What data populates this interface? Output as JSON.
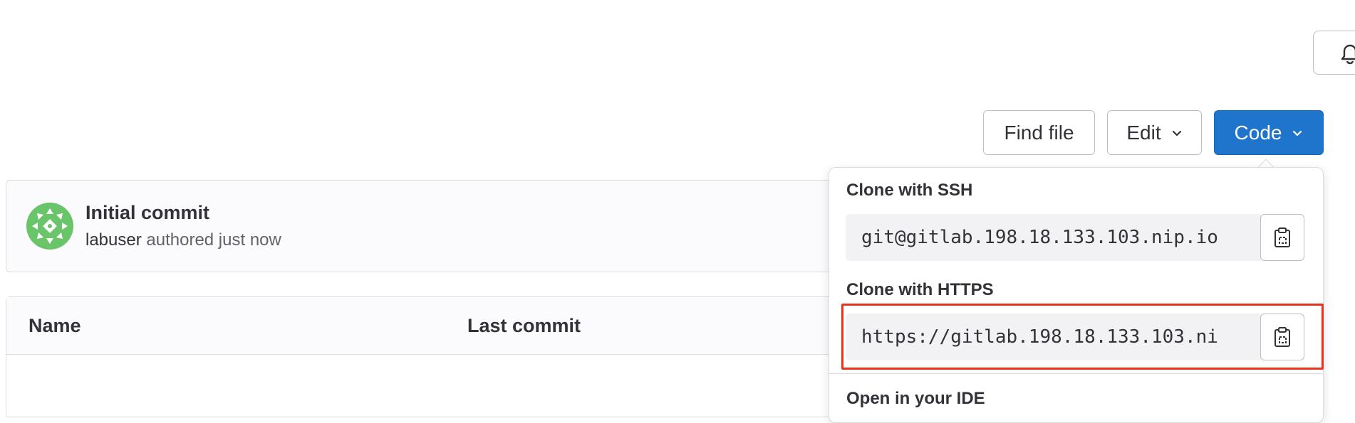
{
  "header": {
    "notifications_icon": "bell-icon"
  },
  "actions": {
    "find_file": "Find file",
    "edit": "Edit",
    "code": "Code",
    "code_color": "#1f75cb"
  },
  "commit": {
    "title": "Initial commit",
    "author": "labuser",
    "meta_suffix": "authored just now",
    "avatar_color": "#6ac46a"
  },
  "table": {
    "columns": [
      "Name",
      "Last commit"
    ]
  },
  "clone_dropdown": {
    "ssh_label": "Clone with SSH",
    "ssh_url": "git@gitlab.198.18.133.103.nip.io",
    "https_label": "Clone with HTTPS",
    "https_url": "https://gitlab.198.18.133.103.ni",
    "ide_label": "Open in your IDE",
    "copy_icon": "clipboard-icon",
    "highlight_color": "#e8331f"
  }
}
